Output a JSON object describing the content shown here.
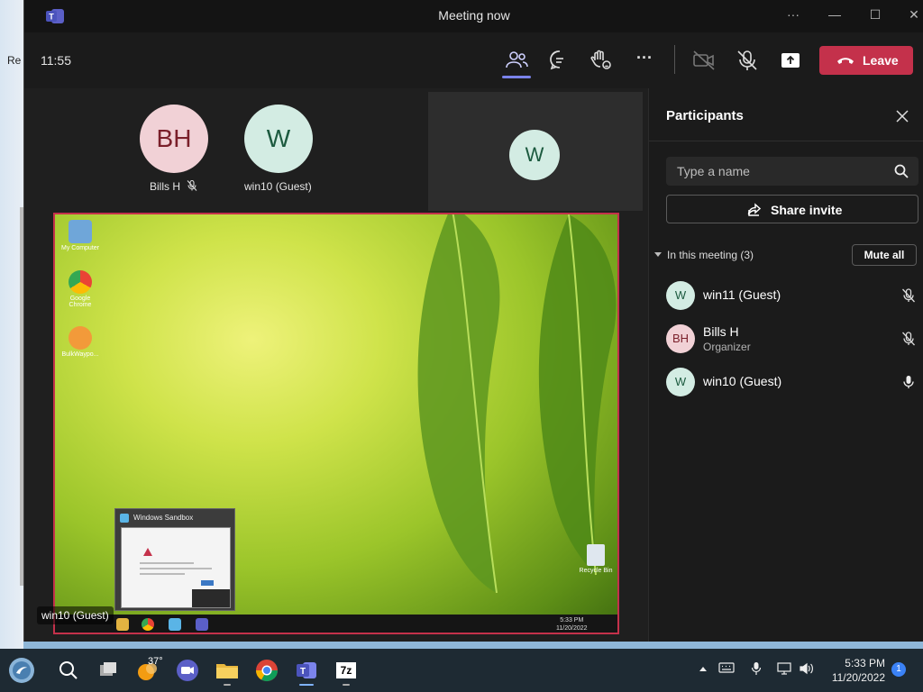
{
  "background_window": {
    "text": "Re"
  },
  "window": {
    "title": "Meeting now",
    "controls": {
      "more": "···",
      "minimize": "—",
      "maximize": "☐",
      "close": "✕"
    }
  },
  "toolbar": {
    "time": "11:55",
    "more_label": "···",
    "leave_label": "Leave",
    "active_icon": "people-icon",
    "accent_color": "#7b83eb",
    "leave_color": "#c4314b"
  },
  "stage": {
    "participants": [
      {
        "initials": "BH",
        "name": "Bills H",
        "muted": true
      },
      {
        "initials": "W",
        "name": "win10 (Guest)",
        "muted": false
      }
    ],
    "tile": {
      "initials": "W"
    },
    "shared_screen": {
      "presenter_label": "win10 (Guest)",
      "desktop_icons": [
        "My Computer",
        "Google Chrome",
        "BulkWaypo..."
      ],
      "recycle_bin": "Recycle Bin",
      "sandbox_popup_title": "Windows Sandbox",
      "clock_time": "5:33 PM",
      "clock_date": "11/20/2022"
    }
  },
  "panel": {
    "title": "Participants",
    "search_placeholder": "Type a name",
    "share_invite": "Share invite",
    "section": "In this meeting (3)",
    "mute_all": "Mute all",
    "people": [
      {
        "initials": "W",
        "name": "win11 (Guest)",
        "role": "",
        "mic": "muted",
        "bg": "#d3ece3",
        "fg": "#1c5a3f"
      },
      {
        "initials": "BH",
        "name": "Bills H",
        "role": "Organizer",
        "mic": "muted",
        "bg": "#f1d1d6",
        "fg": "#7a1f2a"
      },
      {
        "initials": "W",
        "name": "win10 (Guest)",
        "role": "",
        "mic": "on",
        "bg": "#d3ece3",
        "fg": "#1c5a3f"
      }
    ]
  },
  "taskbar": {
    "weather_temp": "37°",
    "pinned": [
      "start",
      "search",
      "task-view",
      "weather",
      "zoom",
      "file-explorer",
      "chrome",
      "teams",
      "7zip"
    ],
    "seven_zip_label": "7z",
    "time": "5:33 PM",
    "date": "11/20/2022",
    "notification_count": "1"
  }
}
